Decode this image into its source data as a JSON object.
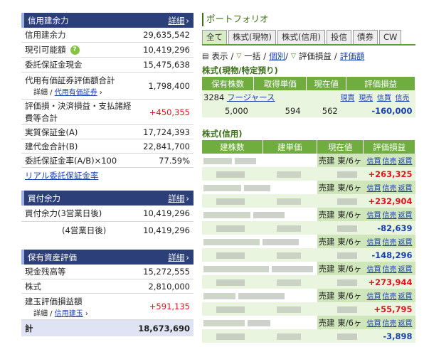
{
  "margin_section": {
    "title": "信用建余力",
    "detail_link": "詳細",
    "rows": [
      {
        "label": "信用建余力",
        "value": "29,635,542"
      },
      {
        "label": "現引可能額",
        "value": "10,419,296",
        "help": "?"
      },
      {
        "label": "委託保証金現金",
        "value": "15,475,638"
      },
      {
        "label": "代用有価証券評価額合計",
        "value": "1,798,400",
        "sub_prefix": "詳細 / ",
        "sub_link": "代用有価証券"
      },
      {
        "label": "評価損・決済損益・支払諸経費等合計",
        "value": "+450,355"
      },
      {
        "label": "実質保証金(A)",
        "value": "17,724,393"
      },
      {
        "label": "建代金合計(B)",
        "value": "22,841,700"
      },
      {
        "label": "委託保証金率(A/B)×100",
        "value": "77.59%"
      }
    ],
    "realtime_link": "リアル委託保証金率"
  },
  "buy_section": {
    "title": "買付余力",
    "detail_link": "詳細",
    "rows": [
      {
        "label": "買付余力(3営業日後)",
        "value": "10,419,296"
      },
      {
        "label": "(4営業日後)",
        "value": "10,419,296"
      }
    ]
  },
  "asset_section": {
    "title": "保有資産評価",
    "detail_link": "詳細",
    "rows": [
      {
        "label": "現金残高等",
        "value": "15,272,555"
      },
      {
        "label": "株式",
        "value": "2,810,000"
      },
      {
        "label": "建玉評価損益額",
        "value": "+591,135",
        "sub_prefix": "詳細 / ",
        "sub_link": "信用建玉"
      }
    ],
    "total_label": "計",
    "total_value": "18,673,690"
  },
  "portfolio": {
    "title": "ポートフォリオ",
    "tabs": [
      "全て",
      "株式(現物)",
      "株式(信用)",
      "投信",
      "債券",
      "CW"
    ],
    "options": {
      "display": "表示",
      "sep1": "/",
      "bulk": "一括",
      "sep2": "/",
      "each": "個別",
      "sep3": "/",
      "pl": "評価損益",
      "sep4": "/",
      "pl_rate": "評価額"
    },
    "cash_heading": "株式(現物/特定預り)",
    "cash_columns": [
      "保有株数",
      "取得単価",
      "現在値",
      "評価損益"
    ],
    "cash_rows": [
      {
        "code": "3284",
        "name": "フージャース",
        "actions": [
          "現買",
          "現売",
          "信買",
          "信売"
        ],
        "shares": "5,000",
        "cost": "594",
        "price": "562",
        "pl": "-160,000"
      }
    ],
    "margin_heading": "株式(信用)",
    "margin_columns": [
      "建株数",
      "建単価",
      "現在値",
      "評価損益"
    ],
    "margin_rows": [
      {
        "type": "売建",
        "market": "東/6ヶ",
        "actions": [
          "信買",
          "信売",
          "返買"
        ],
        "pl": "+263,325"
      },
      {
        "type": "売建",
        "market": "東/6ヶ",
        "actions": [
          "信買",
          "信売",
          "返買"
        ],
        "pl": "+232,904"
      },
      {
        "type": "売建",
        "market": "東/6ヶ",
        "actions": [
          "信買",
          "信売",
          "返買"
        ],
        "pl": "-82,639"
      },
      {
        "type": "売建",
        "market": "東/6ヶ",
        "actions": [
          "信買",
          "信売",
          "返買"
        ],
        "pl": "-148,296"
      },
      {
        "type": "売建",
        "market": "東/6ヶ",
        "actions": [
          "信買",
          "信売",
          "返買"
        ],
        "pl": "+273,944"
      },
      {
        "type": "売建",
        "market": "東/6ヶ",
        "actions": [
          "信買",
          "信売",
          "返買"
        ],
        "pl": "+55,795"
      },
      {
        "type": "売建",
        "market": "東/6ヶ",
        "actions": [
          "信買",
          "信売",
          "返買"
        ],
        "pl": "-3,898"
      }
    ]
  },
  "colors": {
    "nav": "#2c3f78",
    "green_header": "#6fae3e",
    "red": "#e0141e",
    "blue": "#1a3fb0"
  }
}
